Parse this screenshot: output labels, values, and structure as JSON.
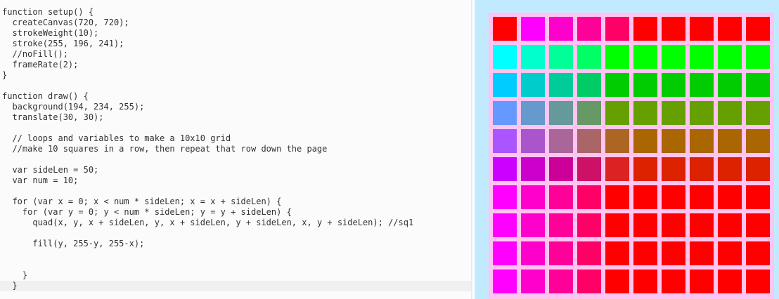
{
  "editor": {
    "lines": [
      "function setup() {",
      "  createCanvas(720, 720);",
      "  strokeWeight(10);",
      "  stroke(255, 196, 241);",
      "  //noFill();",
      "  frameRate(2);",
      "}",
      "",
      "function draw() {",
      "  background(194, 234, 255);",
      "  translate(30, 30);",
      "",
      "  // loops and variables to make a 10x10 grid",
      "  //make 10 squares in a row, then repeat that row down the page",
      "",
      "  var sideLen = 50;",
      "  var num = 10;",
      "",
      "  for (var x = 0; x < num * sideLen; x = x + sideLen) {",
      "    for (var y = 0; y < num * sideLen; y = y + sideLen) {",
      "      quad(x, y, x + sideLen, y, x + sideLen, y + sideLen, x, y + sideLen); //sq1",
      "",
      "      fill(y, 255-y, 255-x);",
      "",
      "",
      "    }",
      "  }"
    ]
  },
  "canvas": {
    "background": "#c2eaff",
    "stroke_color": "#ffc4f1",
    "grid_size": 10,
    "cell_colors": [
      [
        "#ff0000",
        "#ff00ff",
        "#ff00cc",
        "#ff0099",
        "#ff0066",
        "#ff0000",
        "#ff0000",
        "#ff0000",
        "#ff0000",
        "#ff0000"
      ],
      [
        "#00ffff",
        "#00ffcc",
        "#00ff99",
        "#00ff66",
        "#00ff00",
        "#00ff00",
        "#00ff00",
        "#00ff00",
        "#00ff00",
        "#00ff00"
      ],
      [
        "#00ccff",
        "#00cccc",
        "#00cc99",
        "#00cc66",
        "#00cc00",
        "#00cc00",
        "#00cc00",
        "#00cc00",
        "#00cc00",
        "#00cc00"
      ],
      [
        "#6699ff",
        "#6699cc",
        "#669999",
        "#669966",
        "#66a000",
        "#66a000",
        "#66a000",
        "#66a000",
        "#66a000",
        "#66a000"
      ],
      [
        "#aa55ff",
        "#aa55cc",
        "#aa6699",
        "#aa6666",
        "#aa6622",
        "#aa6600",
        "#aa6600",
        "#aa6600",
        "#aa6600",
        "#aa6600"
      ],
      [
        "#cc00ff",
        "#cc00cc",
        "#cc0099",
        "#cc1166",
        "#dd2222",
        "#dd2200",
        "#dd2200",
        "#dd2200",
        "#dd2200",
        "#dd2200"
      ],
      [
        "#ff00ff",
        "#ff00cc",
        "#ff0099",
        "#ff0066",
        "#ff0000",
        "#ff0000",
        "#ff0000",
        "#ff0000",
        "#ff0000",
        "#ff0000"
      ],
      [
        "#ff00ff",
        "#ff00cc",
        "#ff0099",
        "#ff0066",
        "#ff0000",
        "#ff0000",
        "#ff0000",
        "#ff0000",
        "#ff0000",
        "#ff0000"
      ],
      [
        "#ff00ff",
        "#ff00cc",
        "#ff0099",
        "#ff0066",
        "#ff0000",
        "#ff0000",
        "#ff0000",
        "#ff0000",
        "#ff0000",
        "#ff0000"
      ],
      [
        "#ff00ff",
        "#ff00cc",
        "#ff0099",
        "#ff0066",
        "#ff0000",
        "#ff0000",
        "#ff0000",
        "#ff0000",
        "#ff0000",
        "#ff0000"
      ]
    ]
  }
}
